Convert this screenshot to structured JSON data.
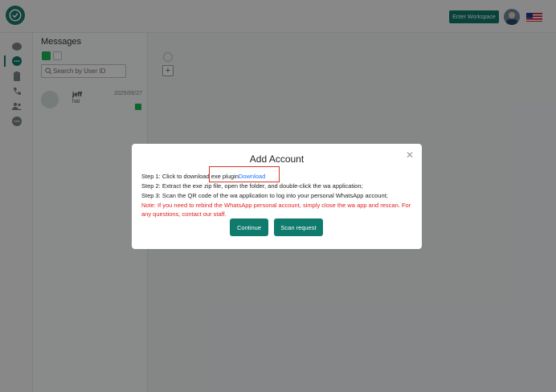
{
  "header": {
    "enter_workspace_label": "Enter Workspace"
  },
  "sidebar": {
    "items": [
      {
        "name": "chat-icon"
      },
      {
        "name": "messages-icon"
      },
      {
        "name": "clipboard-icon"
      },
      {
        "name": "phone-icon"
      },
      {
        "name": "contacts-icon"
      },
      {
        "name": "more-icon"
      }
    ]
  },
  "messages": {
    "title": "Messages",
    "search_placeholder": "Search by User ID",
    "contacts": [
      {
        "name": "jeff",
        "last_message": "hai",
        "date": "2025/06/27"
      }
    ]
  },
  "dialog": {
    "title": "Add Account",
    "step1_prefix": "Step 1: Click to download exe plugin",
    "step1_link": "Download",
    "step2": "Step 2: Extract the exe zip file, open the folder, and double-click the wa application;",
    "step3": "Step 3: Scan the QR code of the wa application to log into your personal WhatsApp account;",
    "note": "Note: If you need to rebind the WhatsApp personal account, simply close the wa app and rescan. For any questions, contact our staff.",
    "continue_label": "Continue",
    "scan_label": "Scan request"
  },
  "colors": {
    "accent": "#0f7b6c",
    "link": "#1677ff",
    "note": "#e12020",
    "highlight": "#d6352b"
  }
}
